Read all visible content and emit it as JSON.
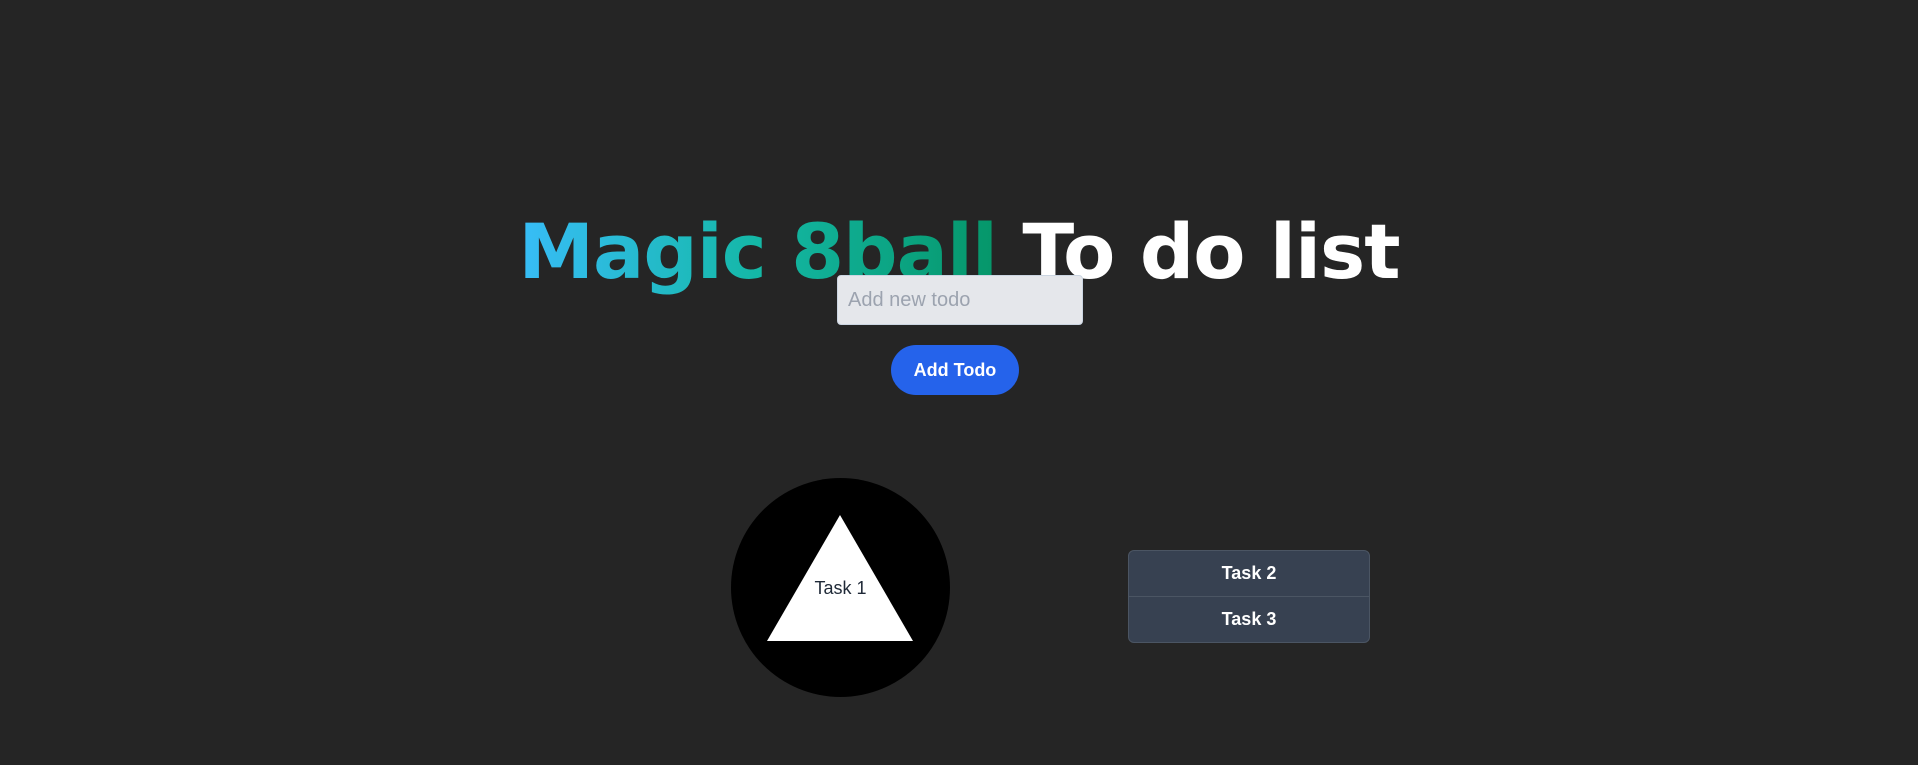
{
  "header": {
    "title_highlight": "Magic 8ball",
    "title_rest": "To do list"
  },
  "form": {
    "input_placeholder": "Add new todo",
    "input_value": "",
    "add_button_label": "Add Todo"
  },
  "eightball": {
    "answer": "Task 1"
  },
  "tasks": [
    {
      "label": "Task 2"
    },
    {
      "label": "Task 3"
    }
  ],
  "colors": {
    "background": "#252525",
    "title_gradient_start": "#38bdf8",
    "title_gradient_end": "#059669",
    "button": "#2563eb",
    "task_item": "#374151"
  }
}
